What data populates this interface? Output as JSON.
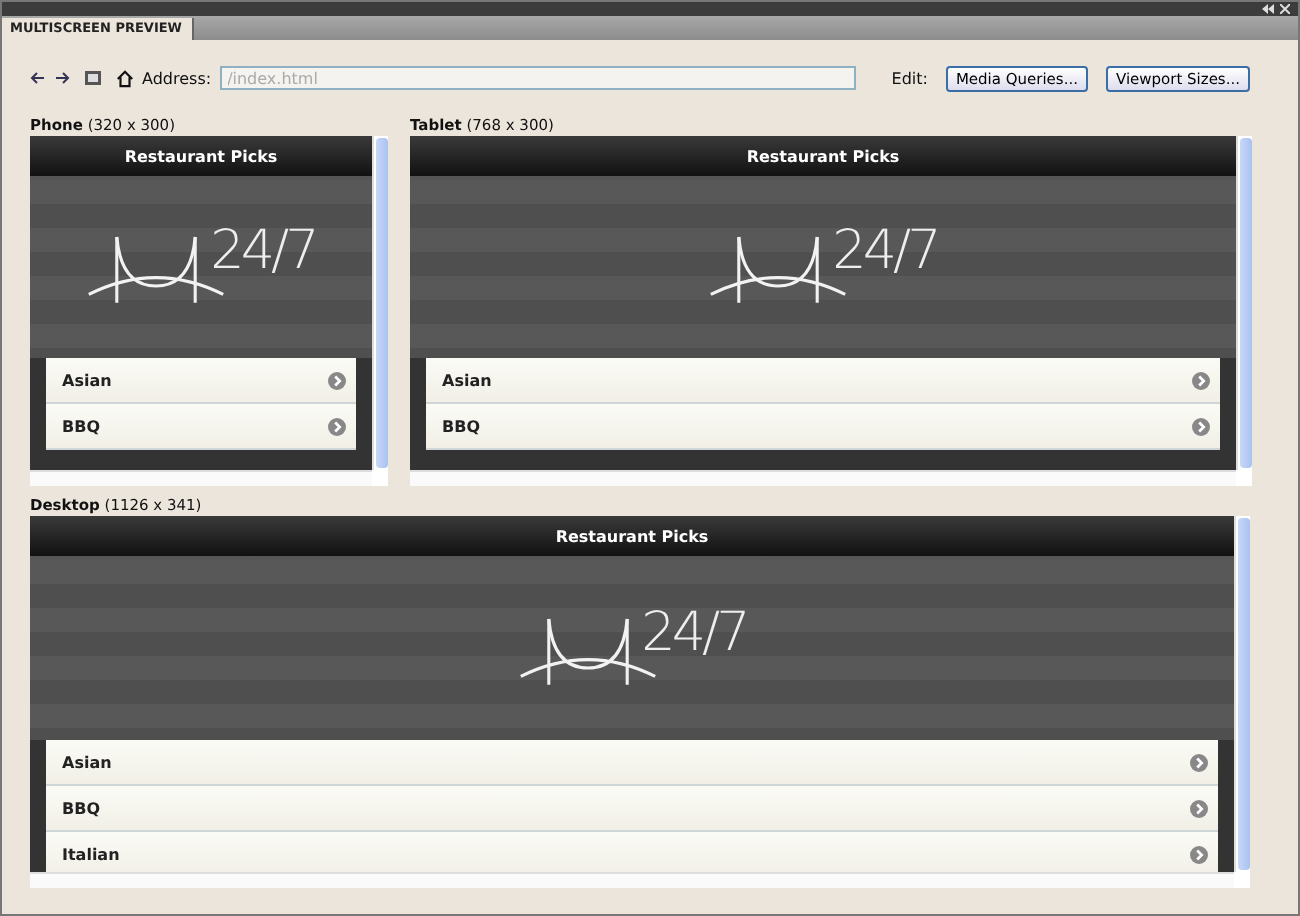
{
  "panel": {
    "tab": "MULTISCREEN PREVIEW"
  },
  "toolbar": {
    "address_label": "Address:",
    "address_placeholder": "/index.html",
    "edit_label": "Edit:",
    "buttons": [
      "Media Queries...",
      "Viewport Sizes..."
    ]
  },
  "panes": [
    {
      "name": "Phone",
      "size": "(320 x 300)",
      "title": "Restaurant Picks",
      "logo_text": "24/7",
      "items": [
        "Asian",
        "BBQ"
      ]
    },
    {
      "name": "Tablet",
      "size": "(768 x 300)",
      "title": "Restaurant Picks",
      "logo_text": "24/7",
      "items": [
        "Asian",
        "BBQ"
      ]
    },
    {
      "name": "Desktop",
      "size": "(1126 x 341)",
      "title": "Restaurant Picks",
      "logo_text": "24/7",
      "items": [
        "Asian",
        "BBQ",
        "Italian"
      ]
    }
  ]
}
